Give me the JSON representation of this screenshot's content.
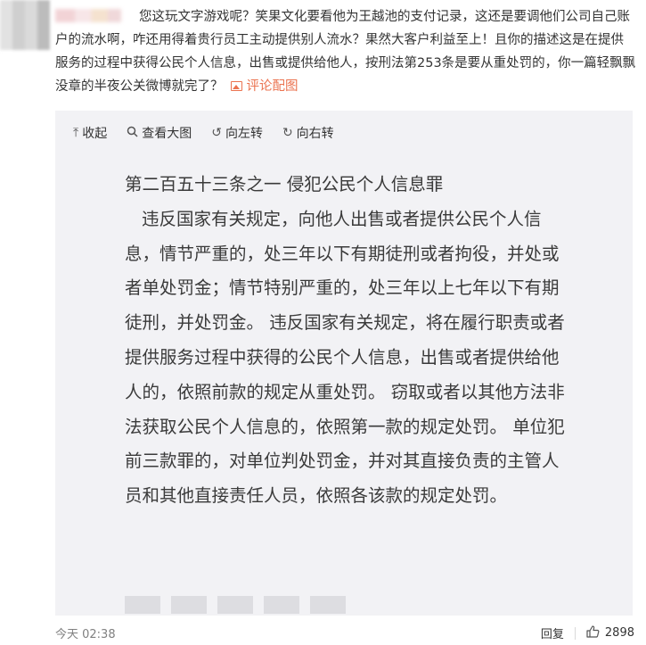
{
  "comment": {
    "text": "您这玩文字游戏呢？笑果文化要看他为王越池的支付记录，这还是要调他们公司自己账户的流水啊，咋还用得着贵行员工主动提供别人流水？果然大客户利益至上！且你的描述这是在提供服务的过程中获得公民个人信息，出售或提供给他人，按刑法第253条是要从重处罚的，你一篇轻飘飘没章的半夜公关微博就完了？",
    "pic_link": "评论配图",
    "pic_icon": "image-icon"
  },
  "toolbar": {
    "collapse": "收起",
    "view_large": "查看大图",
    "rotate_left": "向左转",
    "rotate_right": "向右转",
    "collapse_icon": "up-arrow-icon",
    "view_icon": "search-icon",
    "rotate_left_icon": "rotate-left-icon",
    "rotate_right_icon": "rotate-right-icon"
  },
  "document": {
    "title": "第二百五十三条之一 侵犯公民个人信息罪",
    "body": "违反国家有关规定，向他人出售或者提供公民个人信息，情节严重的，处三年以下有期徒刑或者拘役，并处或者单处罚金；情节特别严重的，处三年以上七年以下有期徒刑，并处罚金。 违反国家有关规定，将在履行职责或者提供服务过程中获得的公民个人信息，出售或者提供给他人的，依照前款的规定从重处罚。 窃取或者以其他方法非法获取公民个人信息的，依照第一款的规定处罚。 单位犯前三款罪的，对单位判处罚金，并对其直接负责的主管人员和其他直接责任人员，依照各该款的规定处罚。"
  },
  "footer": {
    "time": "今天 02:38",
    "reply": "回复",
    "likes": "2898",
    "like_icon": "thumbs-up-icon"
  }
}
